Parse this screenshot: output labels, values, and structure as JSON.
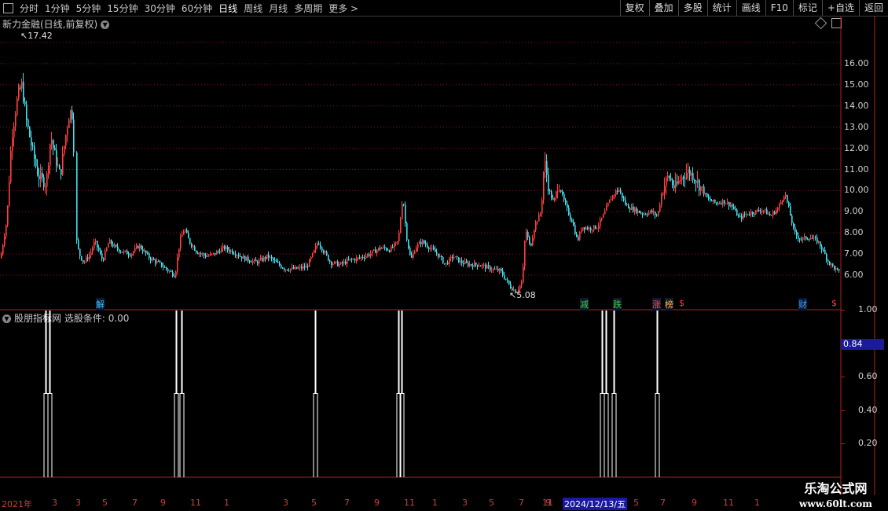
{
  "toolbar": {
    "periods": [
      "分时",
      "1分钟",
      "5分钟",
      "15分钟",
      "30分钟",
      "60分钟",
      "日线",
      "周线",
      "月线",
      "多周期",
      "更多 >"
    ],
    "active_period": "日线",
    "buttons": [
      "复权",
      "叠加",
      "多股",
      "统计",
      "画线",
      "F10",
      "标记",
      "+自选",
      "返回"
    ]
  },
  "main_panel": {
    "title": "新力金融(日线,前复权)",
    "y_ticks": [
      "16.00",
      "15.00",
      "14.00",
      "13.00",
      "12.00",
      "11.00",
      "10.00",
      "9.00",
      "8.00",
      "7.00",
      "6.00"
    ],
    "high_label": "17.42",
    "low_label": "5.08",
    "markers": [
      {
        "text": "解",
        "color": "#40c0ff"
      },
      {
        "text": "减",
        "color": "#40d040"
      },
      {
        "text": "跌",
        "color": "#40d040"
      },
      {
        "text": "涨",
        "color": "#ff5050"
      },
      {
        "text": "榜",
        "color": "#ffb040"
      },
      {
        "text": "$",
        "color": "#ff4040"
      },
      {
        "text": "财",
        "color": "#40a0ff"
      },
      {
        "text": "$",
        "color": "#ff4040"
      }
    ]
  },
  "indicator_panel": {
    "title": "股朋指标网",
    "condition_label": "选股条件: 0.00",
    "y_ticks": [
      "1.00",
      "0.80",
      "0.60",
      "0.40",
      "0.20"
    ],
    "current_value": "0.84"
  },
  "date_axis": {
    "labels": [
      "2021年",
      "3",
      "3",
      "5",
      "7",
      "9",
      "11",
      "1",
      "3",
      "5",
      "7",
      "9",
      "11",
      "1",
      "3",
      "5",
      "7",
      "9",
      "11",
      "2024/12/13/五",
      "5",
      "7",
      "9",
      "11",
      "1"
    ]
  },
  "watermark": {
    "line1": "乐淘公式网",
    "line2": "www.60lt.com"
  },
  "colors": {
    "up": "#ff4040",
    "down": "#40e0f0",
    "grid": "#8a1010",
    "signal": "#ffffff"
  }
}
